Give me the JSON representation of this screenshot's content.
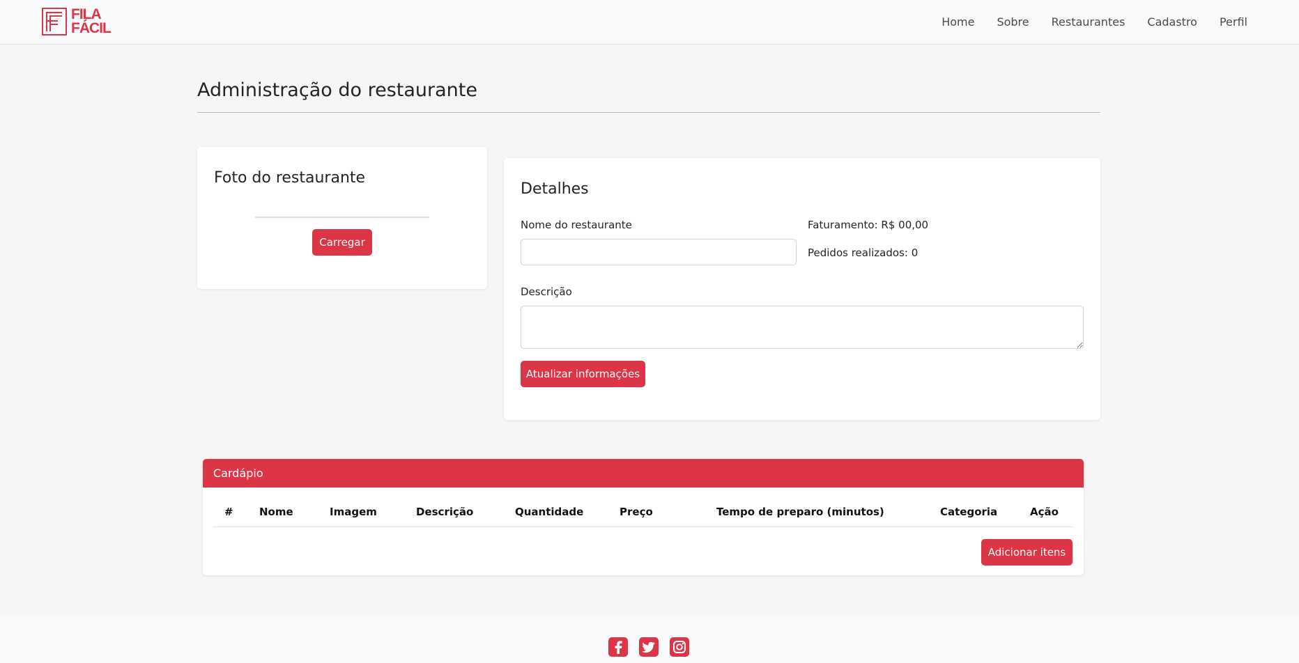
{
  "brand": {
    "line1": "FILA",
    "line2": "FÁCIL",
    "color": "#dc3545"
  },
  "nav": [
    {
      "label": "Home"
    },
    {
      "label": "Sobre"
    },
    {
      "label": "Restaurantes"
    },
    {
      "label": "Cadastro"
    },
    {
      "label": "Perfil"
    }
  ],
  "page": {
    "title": "Administração do restaurante"
  },
  "photo_card": {
    "title": "Foto do restaurante",
    "upload_label": "Carregar"
  },
  "details_card": {
    "title": "Detalhes",
    "name_label": "Nome do restaurante",
    "name_value": "",
    "revenue": "Faturamento: R$ 00,00",
    "orders": "Pedidos realizados: 0",
    "description_label": "Descrição",
    "description_value": "",
    "update_label": "Atualizar informações"
  },
  "menu": {
    "header": "Cardápio",
    "columns": [
      "#",
      "Nome",
      "Imagem",
      "Descrição",
      "Quantidade",
      "Preço",
      "Tempo de preparo (minutos)",
      "Categoria",
      "Ação"
    ],
    "rows": [],
    "add_label": "Adicionar itens"
  },
  "footer": {
    "icons": [
      "facebook-icon",
      "twitter-icon",
      "instagram-icon"
    ]
  },
  "colors": {
    "accent": "#dc3545",
    "background": "#f6f6f6",
    "navbar": "#f8f9fa"
  }
}
